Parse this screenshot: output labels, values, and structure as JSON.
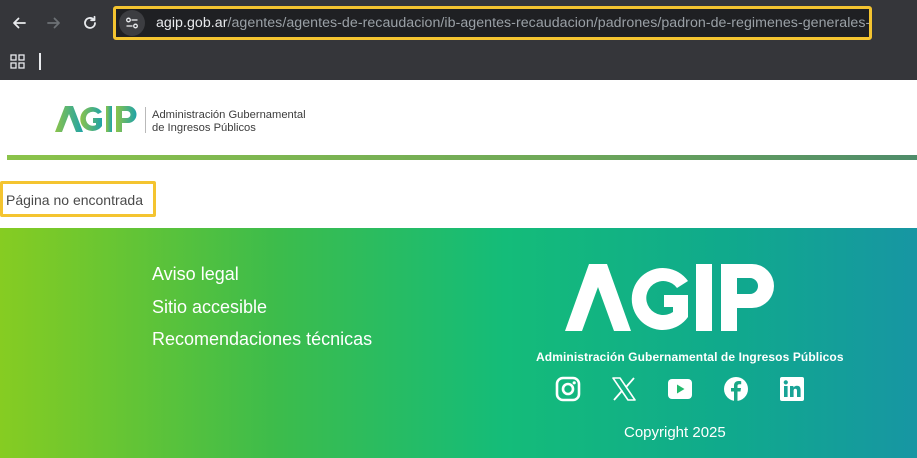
{
  "browser": {
    "url_host": "agip.gob.ar",
    "url_path": "/agentes/agentes-de-recaudacion/ib-agentes-recaudacion/padrones/padron-de-regimenes-generales-",
    "icons": [
      "back-arrow-icon",
      "forward-arrow-icon",
      "reload-icon",
      "site-info-icon",
      "apps-grid-icon"
    ]
  },
  "header": {
    "logo_text": "AGIP",
    "subtitle_line1": "Administración Gubernamental",
    "subtitle_line2": "de Ingresos Públicos"
  },
  "main": {
    "message": "Página no encontrada"
  },
  "footer": {
    "links": [
      "Aviso legal",
      "Sitio accesible",
      "Recomendaciones técnicas"
    ],
    "logo_text": "AGIP",
    "logo_subtitle": "Administración Gubernamental  de Ingresos Públicos",
    "social_icons": [
      "instagram-icon",
      "x-icon",
      "youtube-icon",
      "facebook-icon",
      "linkedin-icon"
    ],
    "copyright": "Copyright 2025"
  },
  "colors": {
    "highlight": "#f4c430",
    "brand_green": "#8bc34a",
    "brand_teal": "#1fa3a8",
    "footer_start": "#86cc22",
    "footer_end": "#1796a3"
  }
}
